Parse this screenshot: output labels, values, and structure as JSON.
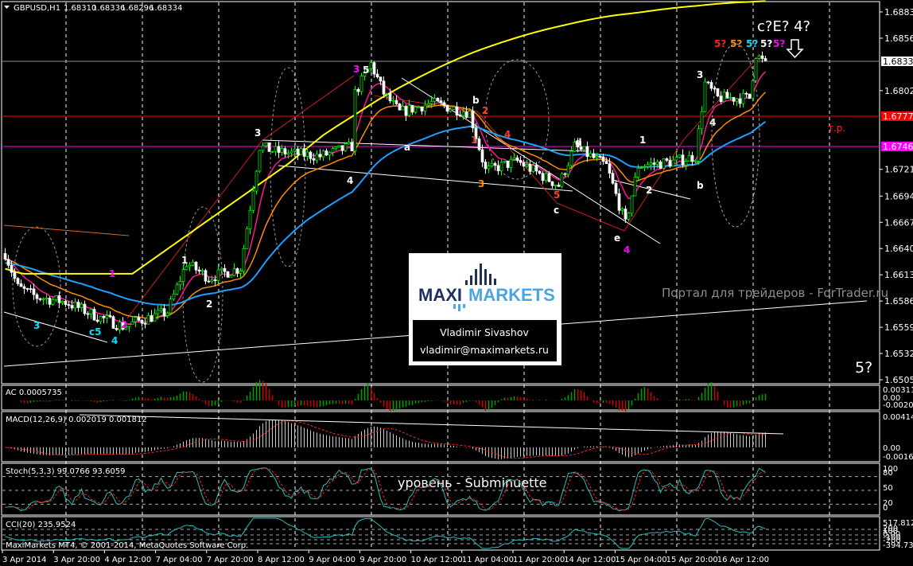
{
  "header": {
    "symbol": "GBPUSD,H1",
    "open": "1.68310",
    "high": "1.68336",
    "low": "1.68296",
    "close": "1.68334"
  },
  "price_axis": [
    "1.68835",
    "1.68565",
    "1.68025",
    "1.67215",
    "1.66940",
    "1.66670",
    "1.66400",
    "1.66130",
    "1.65860",
    "1.65590",
    "1.65320",
    "1.65050"
  ],
  "price_markers": {
    "current": "1.68334",
    "red_level": "1.67774",
    "magenta_level": "1.67460"
  },
  "annotations": {
    "tp": "т.р.",
    "watermark": "Портал для трейдеров - ForTrader.ru",
    "five_q": "5?",
    "top_label": "c?E? 4?",
    "level_note": "уровень - Subminuette",
    "copyright": "MaxiMarkets MT4, © 2001-2014, MetaQuotes Software Corp.",
    "waves": [
      "3",
      "c5",
      "4",
      "2",
      "1",
      "1",
      "2",
      "3",
      "4",
      "3",
      "5",
      "a",
      "b",
      "2",
      "1",
      "4",
      "3",
      "5",
      "c",
      "d",
      "e",
      "4",
      "1",
      "2",
      "b",
      "3",
      "4",
      "5?",
      "5?",
      "5?",
      "5?",
      "5?"
    ]
  },
  "logo": {
    "part1": "MAXI",
    "part2": "MARKETS",
    "name": "Vladimir Sivashov",
    "email": "vladimir@maximarkets.ru"
  },
  "indicators": {
    "ac": {
      "label": "AC 0.0005735",
      "axis": [
        "0.003115",
        "0.00",
        "-0.002033"
      ]
    },
    "macd": {
      "label": "MACD(12,26,9) 0.002019 0.001812",
      "axis": [
        "0.004141",
        "0.00",
        "-0.00164"
      ]
    },
    "stoch": {
      "label": "Stoch(5,3,3) 99.0766 93.6059",
      "axis": [
        "100",
        "80",
        "50",
        "20",
        "0"
      ]
    },
    "cci": {
      "label": "CCI(20) 235.9524",
      "axis": [
        "517.812",
        "200",
        "100",
        "0.00",
        "-100",
        "-200",
        "-394.7378"
      ]
    }
  },
  "time_axis": [
    "3 Apr 2014",
    "3 Apr 20:00",
    "4 Apr 12:00",
    "7 Apr 04:00",
    "7 Apr 20:00",
    "8 Apr 12:00",
    "9 Apr 04:00",
    "9 Apr 20:00",
    "10 Apr 12:00",
    "11 Apr 04:00",
    "11 Apr 20:00",
    "14 Apr 12:00",
    "15 Apr 04:00",
    "15 Apr 20:00",
    "16 Apr 12:00"
  ],
  "colors": {
    "bull": "#00ff00",
    "bear": "#ffffff",
    "red_level": "#ff0000",
    "magenta_level": "#ff00ff",
    "ema_fast": "#ff1493",
    "ema_mid": "#ff8c00",
    "ema_slow": "#1e9fff",
    "ma_long": "#ffff00"
  },
  "chart_data": {
    "type": "candlestick",
    "symbol": "GBPUSD",
    "timeframe": "H1",
    "ylim": [
      1.6505,
      1.68835
    ],
    "waypoints_bar_price": [
      [
        0,
        1.6635
      ],
      [
        4,
        1.66
      ],
      [
        10,
        1.659
      ],
      [
        19,
        1.6585
      ],
      [
        29,
        1.657
      ],
      [
        37,
        1.656
      ],
      [
        51,
        1.6575
      ],
      [
        57,
        1.6625
      ],
      [
        64,
        1.661
      ],
      [
        74,
        1.662
      ],
      [
        80,
        1.6745
      ],
      [
        85,
        1.674
      ],
      [
        99,
        1.6735
      ],
      [
        109,
        1.6745
      ],
      [
        110,
        1.68
      ],
      [
        115,
        1.683
      ],
      [
        119,
        1.68
      ],
      [
        124,
        1.678
      ],
      [
        134,
        1.679
      ],
      [
        146,
        1.678
      ],
      [
        151,
        1.672
      ],
      [
        161,
        1.673
      ],
      [
        174,
        1.6705
      ],
      [
        179,
        1.6745
      ],
      [
        189,
        1.6725
      ],
      [
        195,
        1.6665
      ],
      [
        199,
        1.6725
      ],
      [
        211,
        1.673
      ],
      [
        217,
        1.6735
      ],
      [
        220,
        1.681
      ],
      [
        224,
        1.6795
      ],
      [
        234,
        1.6795
      ],
      [
        236,
        1.684
      ],
      [
        238,
        1.6833
      ]
    ]
  }
}
